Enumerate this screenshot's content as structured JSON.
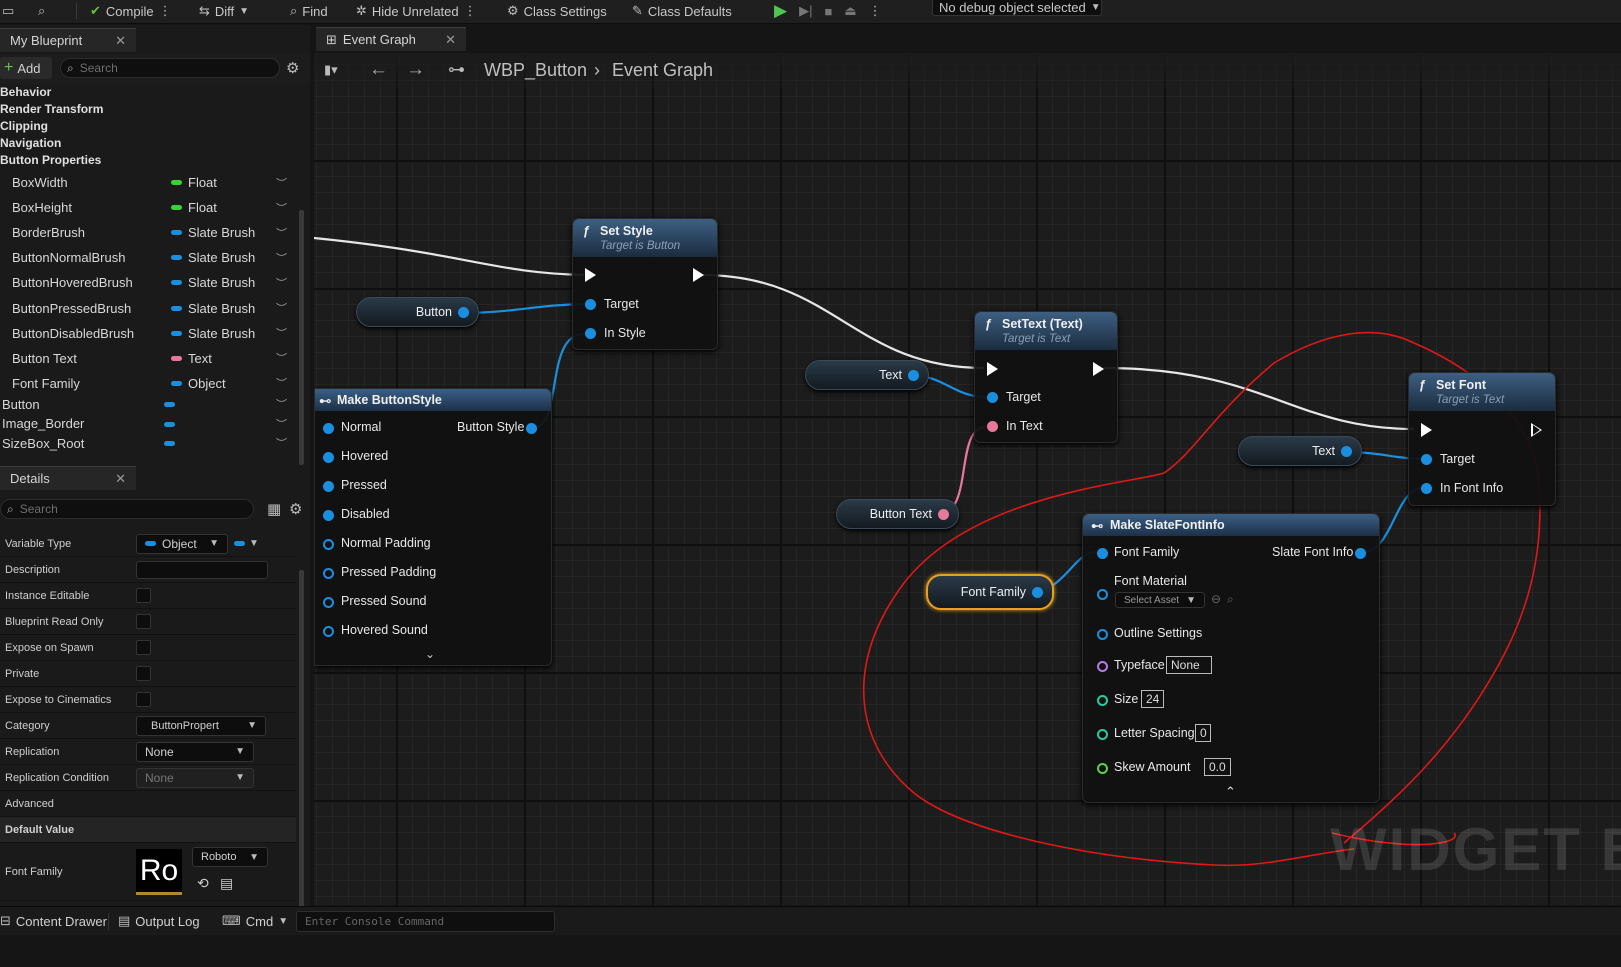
{
  "toolbar": {
    "compile": "Compile",
    "diff": "Diff",
    "find": "Find",
    "hide_unrelated": "Hide Unrelated",
    "class_settings": "Class Settings",
    "class_defaults": "Class Defaults",
    "debug_select": "No debug object selected"
  },
  "my_blueprint": {
    "tab": "My Blueprint",
    "add": "Add",
    "search_placeholder": "Search",
    "categories": [
      "Behavior",
      "Render Transform",
      "Clipping",
      "Navigation",
      "Button Properties"
    ],
    "variables": [
      {
        "name": "BoxWidth",
        "type": "Float",
        "color": "#38d238"
      },
      {
        "name": "BoxHeight",
        "type": "Float",
        "color": "#38d238"
      },
      {
        "name": "BorderBrush",
        "type": "Slate Brush",
        "color": "#1a8fe0"
      },
      {
        "name": "ButtonNormalBrush",
        "type": "Slate Brush",
        "color": "#1a8fe0"
      },
      {
        "name": "ButtonHoveredBrush",
        "type": "Slate Brush",
        "color": "#1a8fe0"
      },
      {
        "name": "ButtonPressedBrush",
        "type": "Slate Brush",
        "color": "#1a8fe0"
      },
      {
        "name": "ButtonDisabledBrush",
        "type": "Slate Brush",
        "color": "#1a8fe0"
      },
      {
        "name": "Button Text",
        "type": "Text",
        "color": "#e8789a"
      },
      {
        "name": "Font Family",
        "type": "Object",
        "color": "#1a8fe0"
      }
    ],
    "widgets": [
      "Button",
      "Image_Border",
      "SizeBox_Root"
    ]
  },
  "details": {
    "tab": "Details",
    "search_placeholder": "Search",
    "variable_type_label": "Variable Type",
    "variable_type_value": "Object",
    "description_label": "Description",
    "instance_editable_label": "Instance Editable",
    "blueprint_read_only_label": "Blueprint Read Only",
    "expose_on_spawn_label": "Expose on Spawn",
    "private_label": "Private",
    "expose_to_cinematics_label": "Expose to Cinematics",
    "category_label": "Category",
    "category_value": "ButtonPropert",
    "replication_label": "Replication",
    "replication_value": "None",
    "replication_condition_label": "Replication Condition",
    "replication_condition_value": "None",
    "advanced_label": "Advanced",
    "default_value_label": "Default Value",
    "font_family_label": "Font Family",
    "font_thumb": "Ro",
    "font_value": "Roboto"
  },
  "graph": {
    "tab": "Event Graph",
    "breadcrumb_root": "WBP_Button",
    "breadcrumb_leaf": "Event Graph",
    "watermark": "WIDGET B",
    "nodes": {
      "set_style": {
        "title": "Set Style",
        "subtitle": "Target is Button",
        "target": "Target",
        "in_style": "In Style"
      },
      "set_text": {
        "title": "SetText (Text)",
        "subtitle": "Target is Text",
        "target": "Target",
        "in_text": "In Text"
      },
      "set_font": {
        "title": "Set Font",
        "subtitle": "Target is Text",
        "target": "Target",
        "in_font_info": "In Font Info"
      },
      "make_button_style": {
        "title": "Make ButtonStyle",
        "output": "Button Style",
        "inputs": [
          "Normal",
          "Hovered",
          "Pressed",
          "Disabled",
          "Normal Padding",
          "Pressed Padding",
          "Pressed Sound",
          "Hovered Sound"
        ]
      },
      "make_font_info": {
        "title": "Make SlateFontInfo",
        "output": "Slate Font Info",
        "font_family": "Font Family",
        "font_material": "Font Material",
        "select_asset": "Select Asset",
        "outline_settings": "Outline Settings",
        "typeface": "Typeface",
        "typeface_value": "None",
        "size": "Size",
        "size_value": "24",
        "letter_spacing": "Letter Spacing",
        "letter_spacing_value": "0",
        "skew_amount": "Skew Amount",
        "skew_amount_value": "0.0"
      }
    },
    "getters": {
      "button": "Button",
      "text1": "Text",
      "text2": "Text",
      "button_text": "Button Text",
      "font_family": "Font Family"
    }
  },
  "statusbar": {
    "content_drawer": "Content Drawer",
    "output_log": "Output Log",
    "cmd": "Cmd",
    "console_placeholder": "Enter Console Command"
  }
}
